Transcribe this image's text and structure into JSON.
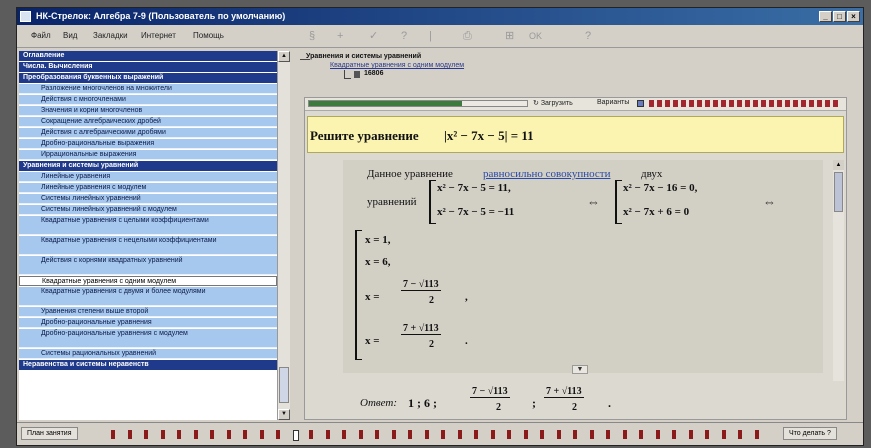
{
  "window": {
    "title": "НК-Стрелок: Алгебра 7-9 (Пользователь по умолчанию)",
    "buttons": [
      "_",
      "□",
      "×"
    ]
  },
  "menu": {
    "items": [
      "Файл",
      "Вид",
      "Закладки",
      "Интернет",
      "Помощь"
    ],
    "ok_label": "OK",
    "tools": [
      "§",
      "+",
      "✓",
      "?",
      "|",
      "⎙",
      "⊞",
      "?"
    ]
  },
  "sidebar": {
    "rows": [
      {
        "type": "head",
        "label": "Оглавление"
      },
      {
        "type": "head",
        "label": "Числа. Вычисления"
      },
      {
        "type": "head",
        "label": "Преобразования буквенных выражений"
      },
      {
        "type": "item",
        "label": "Разложение многочленов на множители"
      },
      {
        "type": "item",
        "label": "Действия с многочленами"
      },
      {
        "type": "item",
        "label": "Значения и корни многочленов"
      },
      {
        "type": "item",
        "label": "Сокращение алгебраических дробей"
      },
      {
        "type": "item",
        "label": "Действия с алгебраическими дробями"
      },
      {
        "type": "item",
        "label": "Дробно-рациональные выражения"
      },
      {
        "type": "item",
        "label": "Иррациональные выражения"
      },
      {
        "type": "head",
        "label": "Уравнения и системы уравнений"
      },
      {
        "type": "item",
        "label": "Линейные уравнения"
      },
      {
        "type": "item",
        "label": "Линейные уравнения с модулем"
      },
      {
        "type": "item",
        "label": "Системы линейных уравнений"
      },
      {
        "type": "item",
        "label": "Системы линейных уравнений с модулем"
      },
      {
        "type": "item",
        "label": "Квадратные уравнения с целыми коэффициентами"
      },
      {
        "type": "item",
        "label": "Квадратные уравнения с нецелыми коэффициентами"
      },
      {
        "type": "item",
        "label": "Действия с корнями квадратных уравнений"
      },
      {
        "type": "item",
        "label": "Квадратные уравнения с одним модулем",
        "selected": true
      },
      {
        "type": "item",
        "label": "Квадратные уравнения с двумя и более модулями"
      },
      {
        "type": "item",
        "label": "Уравнения степени выше второй"
      },
      {
        "type": "item",
        "label": "Дробно-рациональные уравнения"
      },
      {
        "type": "item",
        "label": "Дробно-рациональные уравнения с модулем"
      },
      {
        "type": "item",
        "label": "Системы рациональных уравнений"
      },
      {
        "type": "head",
        "label": "Неравенства и системы неравенств"
      }
    ]
  },
  "tree": {
    "root": "Уравнения и системы уравнений",
    "child": "Квадратные уравнения с одним модулем",
    "leaf": "16806"
  },
  "panel_toolbar": {
    "progress": 0.7,
    "load_label": "Загрузить",
    "variants_label": "Варианты"
  },
  "problem": {
    "prompt": "Решите уравнение",
    "equation": "|x² − 7x − 5| = 11"
  },
  "solution": {
    "intro_start": "Данное уравнение",
    "intro_link": "равносильно совокупности",
    "intro_end": "двух",
    "intro_line2": "уравнений",
    "sys1": [
      "x² − 7x − 5 = 11,",
      "x² − 7x − 5 = −11"
    ],
    "sys2": [
      "x² − 7x − 16 = 0,",
      "x² − 7x + 6 = 0"
    ],
    "iff": "⇔",
    "roots": [
      "x = 1,",
      "x = 6,",
      "x = ",
      "x = "
    ],
    "frac1_num": "7 − √113",
    "frac2_num": "7 + √113",
    "frac_den": "2",
    "punct": [
      ",",
      "."
    ]
  },
  "answer": {
    "label": "Ответ:",
    "values": "1 ; 6 ;",
    "frac1_num": "7 − √113",
    "frac2_num": "7 + √113",
    "frac_den": "2",
    "sep": ";",
    "end": "."
  },
  "statusbar": {
    "left_label": "План занятия",
    "right_label": "Что делать ?",
    "active_index": 11
  }
}
